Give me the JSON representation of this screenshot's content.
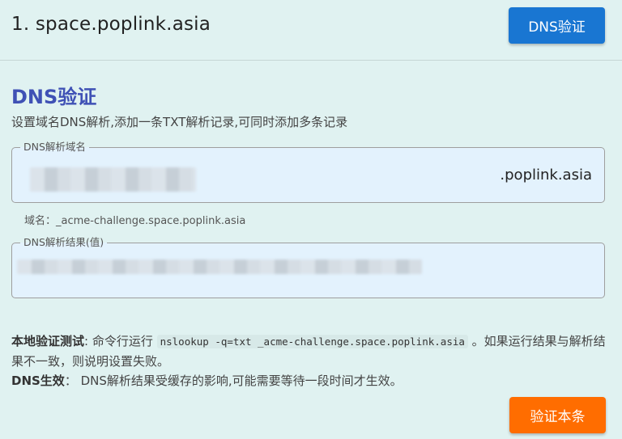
{
  "header": {
    "domain_title": "1.  space.poplink.asia",
    "dns_button": "DNS验证"
  },
  "section": {
    "title": "DNS验证",
    "subtitle": "设置域名DNS解析,添加一条TXT解析记录,可同时添加多条记录"
  },
  "dns_name_field": {
    "legend": "DNS解析域名",
    "suffix": ".poplink.asia",
    "helper": "域名：_acme-challenge.space.poplink.asia"
  },
  "dns_value_field": {
    "legend": "DNS解析结果(值)"
  },
  "info": {
    "local_label": "本地验证测试",
    "local_prefix": ": 命令行运行 ",
    "command": "nslookup -q=txt _acme-challenge.space.poplink.asia",
    "local_suffix": " 。如果运行结果与解析结果不一致，则说明设置失败。",
    "effect_label": "DNS生效",
    "effect_text": "：  DNS解析结果受缓存的影响,可能需要等待一段时间才生效。"
  },
  "actions": {
    "verify_button": "验证本条"
  },
  "colors": {
    "background": "#e0f2f1",
    "primary_button": "#1976d2",
    "accent_button": "#ff6d00",
    "section_title": "#3f51b5",
    "field_background": "#e3f2fd"
  }
}
